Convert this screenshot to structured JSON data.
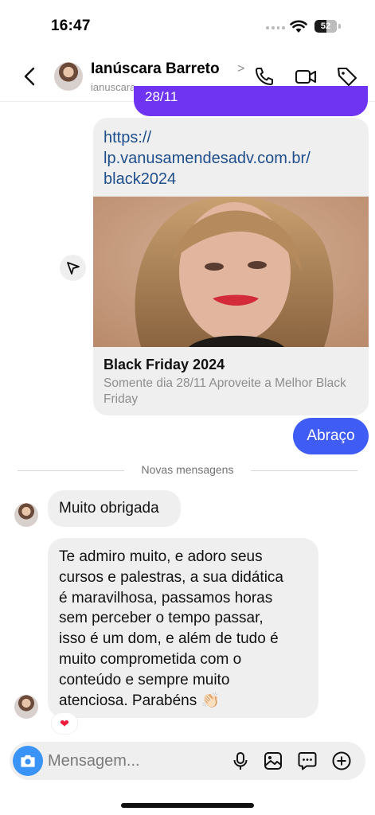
{
  "status_bar": {
    "time": "16:47",
    "battery": "52",
    "battery_level": 0.52
  },
  "header": {
    "name": "Ianúscara Barreto",
    "chevron": ">",
    "username": "ianuscara",
    "icons": [
      "back-icon",
      "phone-icon",
      "video-icon",
      "tag-icon"
    ]
  },
  "messages": {
    "previous_sent_partial": "28/11",
    "link_card": {
      "url": "https://lp.vanusamendesadv.com.br/black2024",
      "url_lines": [
        "https://",
        "lp.vanusamendesadv.com.br/",
        "black2024"
      ],
      "title": "Black Friday 2024",
      "description": "Somente dia 28/11 Aproveite a Melhor Black Friday"
    },
    "sent": "Abraço",
    "divider": "Novas mensagens",
    "received": [
      {
        "text_lines": [
          "Muito obrigada"
        ]
      },
      {
        "text_lines": [
          "Te admiro muito, e adoro seus",
          "cursos e palestras, a sua didática",
          "é maravilhosa, passamos horas",
          "sem perceber o tempo passar,",
          "isso é um dom, e além de tudo é",
          "muito comprometida com o",
          "conteúdo e sempre muito",
          "atenciosa. Parabéns 👏🏻"
        ]
      }
    ],
    "reaction": "❤"
  },
  "composer": {
    "placeholder": "Mensagem...",
    "icons": [
      "camera-icon",
      "mic-icon",
      "gallery-icon",
      "sticker-icon",
      "plus-icon"
    ]
  },
  "colors": {
    "sent_bubble": "#3f5cf5",
    "purple_bubble": "#6e34f2",
    "received_bubble": "#efefef",
    "camera_button": "#3a93f6",
    "link_blue": "#1f4e8c"
  }
}
